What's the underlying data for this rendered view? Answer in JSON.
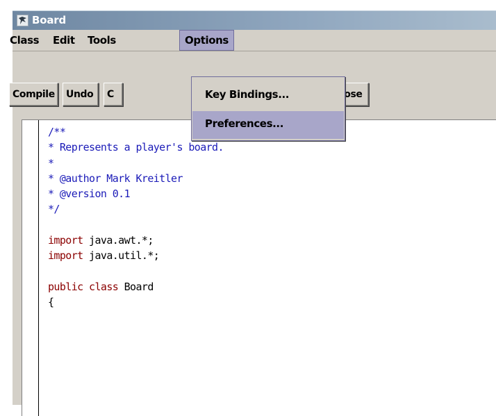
{
  "window": {
    "title": "Board",
    "icon": "bluej-app-icon"
  },
  "menubar": {
    "items": [
      {
        "label": "Class"
      },
      {
        "label": "Edit"
      },
      {
        "label": "Tools"
      },
      {
        "label": "Options",
        "active": true
      }
    ]
  },
  "options_menu": {
    "items": [
      {
        "label": "Key Bindings..."
      },
      {
        "label": "Preferences...",
        "highlighted": true
      }
    ]
  },
  "toolbar": {
    "buttons": [
      {
        "label": "Compile"
      },
      {
        "label": "Undo"
      },
      {
        "label": "C"
      },
      {
        "label": "Close"
      }
    ]
  },
  "editor": {
    "lines": [
      "/**",
      "* Represents a player's board.",
      "*",
      "* @author Mark Kreitler",
      "* @version 0.1",
      "*/",
      "",
      "import java.awt.*;",
      "import java.util.*;",
      "",
      "public class Board",
      "{"
    ],
    "keywords": {
      "import": "import",
      "public": "public",
      "class": "class"
    },
    "line_rest": {
      "import_awt": " java.awt.*;",
      "import_util": " java.util.*;",
      "class_name": " Board"
    }
  },
  "colors": {
    "titlebar": "#7c93ad",
    "menu_highlight": "#a8a6c9",
    "comment_text": "#1b1bb8",
    "keyword_text": "#8b0000"
  }
}
